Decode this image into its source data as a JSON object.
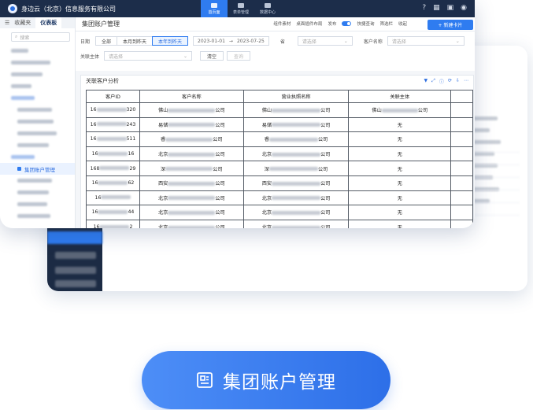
{
  "colors": {
    "accent": "#2f7cf0",
    "nav_dark": "#1c2d4a",
    "pill_start": "#4d8ef7",
    "pill_end": "#2d6fe8"
  },
  "topbar": {
    "company": "身边云（北京）信息服务有限公司",
    "tabs": [
      {
        "label": "首页面",
        "active": true
      },
      {
        "label": "表单管理",
        "active": false
      },
      {
        "label": "数据中心",
        "active": false
      }
    ],
    "icons": [
      "help-icon",
      "grid-icon",
      "notification-icon",
      "user-icon"
    ]
  },
  "sidebar": {
    "tabs": [
      "收藏夹",
      "仪表板"
    ],
    "active_tab": "仪表板",
    "search_placeholder": "搜索",
    "active_item": "集团账户管理"
  },
  "page": {
    "title": "集团账户管理",
    "tools": [
      "组件素材",
      "桌面插件布局",
      "发布",
      "快捷查询",
      "筛选栏",
      "收起"
    ],
    "new_button": "+ 新建卡片"
  },
  "filters": {
    "date_label": "日期",
    "segments": [
      "全部",
      "本月到昨天",
      "本年到昨天"
    ],
    "active_segment": "本年到昨天",
    "date_start": "2023-01-01",
    "date_sep": "→",
    "date_end": "2023-07-25",
    "filter2_label": "省",
    "filter2_placeholder": "请选择",
    "customer_label": "客户名称",
    "customer_placeholder": "请选择",
    "related_label": "关联主体",
    "related_placeholder": "请选择",
    "clear_button": "清空",
    "query_button": "查询"
  },
  "panel": {
    "title": "关联客户分析",
    "columns": [
      "客户ID",
      "客户名称",
      "营业执照名称",
      "关联主体"
    ],
    "rows": [
      {
        "id_start": "16",
        "id_end": "320",
        "name_start": "佛山",
        "name_end": "公司",
        "license_start": "佛山",
        "license_end": "公司",
        "related_start": "佛山",
        "related_end": "公司"
      },
      {
        "id_start": "16",
        "id_end": "243",
        "name_start": "易储",
        "name_end": "公司",
        "license_start": "易储",
        "license_end": "公司",
        "related_start": "",
        "related_end": "无"
      },
      {
        "id_start": "16",
        "id_end": "511",
        "name_start": "睿",
        "name_end": "公司",
        "license_start": "睿",
        "license_end": "公司",
        "related_start": "",
        "related_end": "无"
      },
      {
        "id_start": "16",
        "id_end": "16",
        "name_start": "北京",
        "name_end": "公司",
        "license_start": "北京",
        "license_end": "公司",
        "related_start": "",
        "related_end": "无"
      },
      {
        "id_start": "168",
        "id_end": "29",
        "name_start": "深",
        "name_end": "公司",
        "license_start": "深",
        "license_end": "公司",
        "related_start": "",
        "related_end": "无"
      },
      {
        "id_start": "16",
        "id_end": "62",
        "name_start": "西安",
        "name_end": "公司",
        "license_start": "西安",
        "license_end": "公司",
        "related_start": "",
        "related_end": "无"
      },
      {
        "id_start": "16",
        "id_end": "",
        "name_start": "北京",
        "name_end": "公司",
        "license_start": "北京",
        "license_end": "公司",
        "related_start": "",
        "related_end": "无"
      },
      {
        "id_start": "16",
        "id_end": "44",
        "name_start": "北京",
        "name_end": "公司",
        "license_start": "北京",
        "license_end": "公司",
        "related_start": "",
        "related_end": "无"
      },
      {
        "id_start": "16",
        "id_end": "2",
        "name_start": "北京",
        "name_end": "公司",
        "license_start": "北京",
        "license_end": "公司",
        "related_start": "",
        "related_end": "无"
      }
    ]
  },
  "cta": {
    "label": "集团账户管理",
    "icon": "building-icon"
  }
}
